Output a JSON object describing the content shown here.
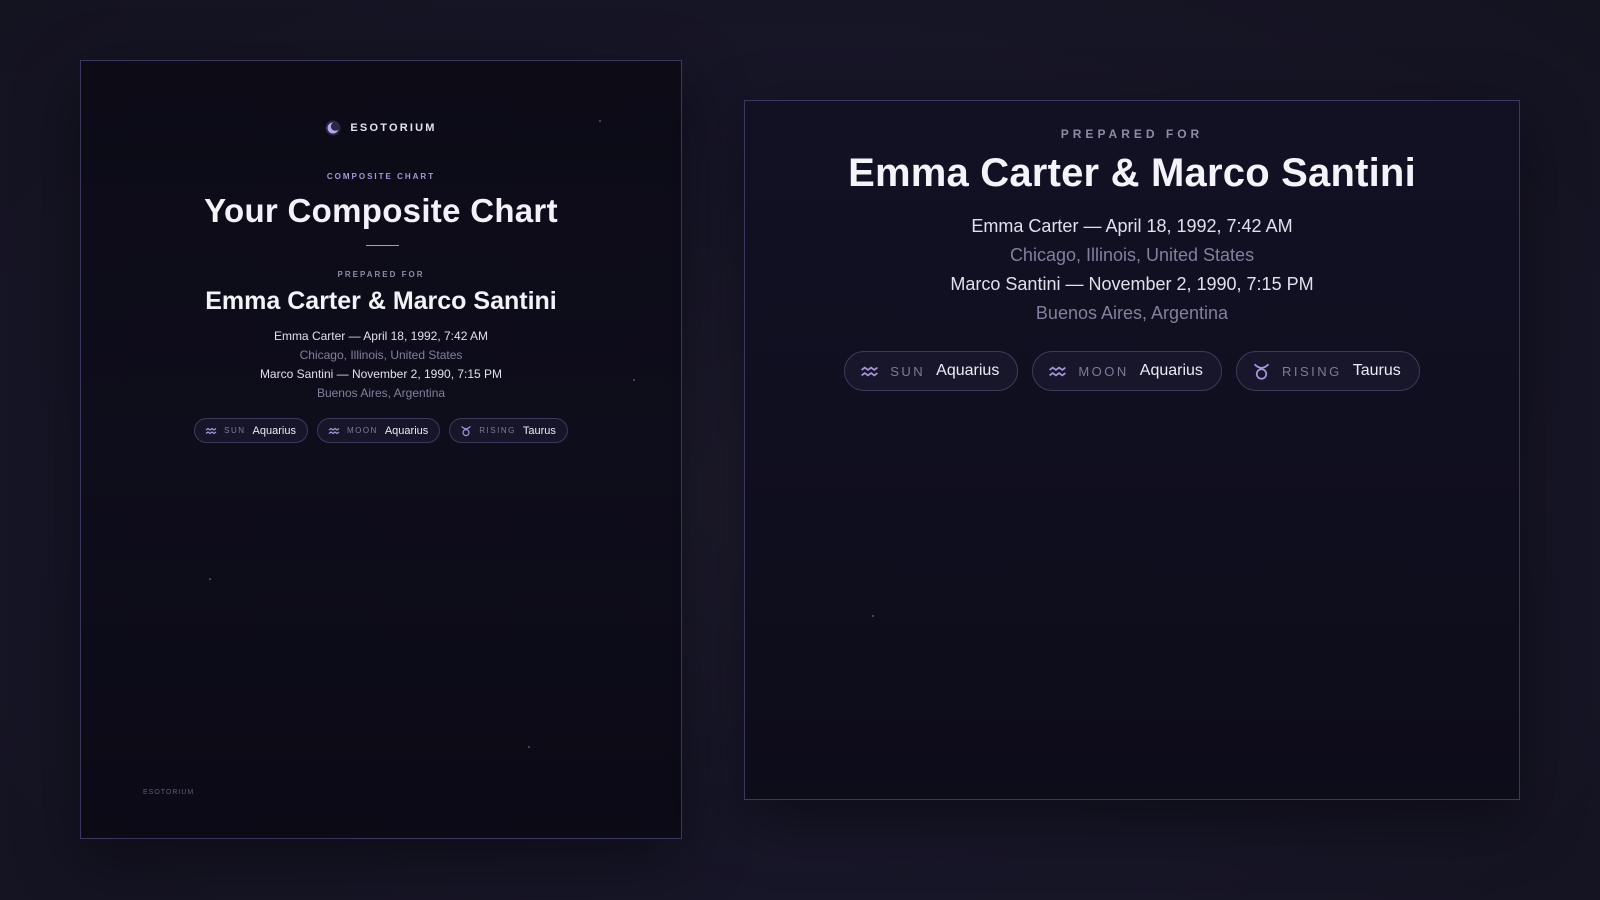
{
  "brand": {
    "name": "ESOTORIUM",
    "footer": "ESOTORIUM",
    "accent_color": "#a697d8",
    "divider_color": "#c59a74"
  },
  "page": {
    "eyebrow": "COMPOSITE CHART",
    "title": "Your Composite Chart"
  },
  "prepared": {
    "label": "PREPARED FOR",
    "names": "Emma Carter & Marco Santini",
    "person1": {
      "line": "Emma Carter — April 18, 1992, 7:42 AM",
      "place": "Chicago, Illinois, United States"
    },
    "person2": {
      "line": "Marco Santini — November 2, 1990, 7:15 PM",
      "place": "Buenos Aires, Argentina"
    }
  },
  "placements": [
    {
      "label": "SUN",
      "value": "Aquarius",
      "icon": "aquarius-icon"
    },
    {
      "label": "MOON",
      "value": "Aquarius",
      "icon": "aquarius-icon"
    },
    {
      "label": "RISING",
      "value": "Taurus",
      "icon": "taurus-icon"
    }
  ]
}
